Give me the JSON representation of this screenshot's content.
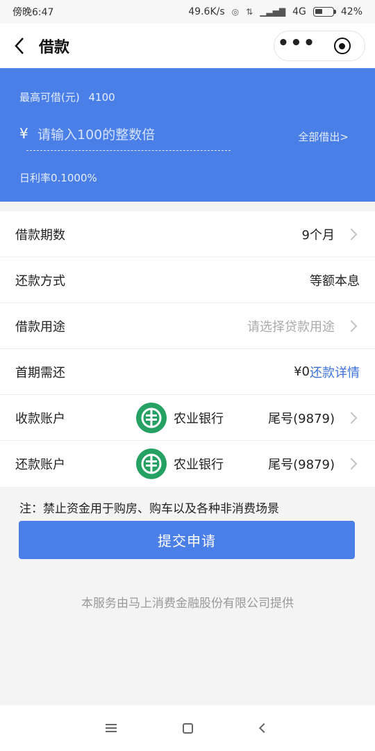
{
  "status_bar": {
    "time": "傍晚6:47",
    "network_speed": "49.6K/s",
    "network_type": "4G",
    "battery_percent": "42%",
    "battery_level": 0.42
  },
  "header": {
    "title": "借款",
    "back_icon": "chevron-left-icon",
    "more_icon": "more-dots-icon",
    "close_icon": "target-icon"
  },
  "banner": {
    "max_limit_label": "最高可借(元)",
    "max_limit_value": "4100",
    "currency_symbol": "¥",
    "amount_placeholder": "请输入100的整数倍",
    "borrow_all": "全部借出>",
    "daily_rate": "日利率0.1000%",
    "background_color": "#4a7fe8"
  },
  "form": {
    "rows": [
      {
        "label": "借款期数",
        "value": "9个月"
      },
      {
        "label": "还款方式",
        "value": "等额本息"
      },
      {
        "label": "借款用途",
        "placeholder": "请选择贷款用途"
      },
      {
        "label": "首期需还",
        "value": "¥0",
        "link": "还款详情"
      },
      {
        "label": "收款账户",
        "bank_name": "农业银行",
        "tail_number": "尾号(9879)"
      },
      {
        "label": "还款账户",
        "bank_name": "农业银行",
        "tail_number": "尾号(9879)"
      }
    ]
  },
  "note": "注：禁止资金用于购房、购车以及各种非消费场景",
  "submit_button": "提交申请",
  "provider": "本服务由马上消费金融股份有限公司提供",
  "colors": {
    "accent": "#4a7fe8",
    "link": "#3c73d8",
    "bank_green": "#24a163"
  }
}
